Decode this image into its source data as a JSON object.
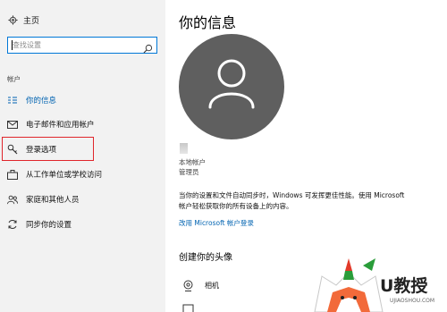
{
  "sidebar": {
    "home_label": "主页",
    "search_placeholder": "查找设置",
    "section_label": "帐户",
    "items": [
      {
        "label": "你的信息",
        "icon": "person-card-icon",
        "active": true
      },
      {
        "label": "电子邮件和应用帐户",
        "icon": "mail-icon"
      },
      {
        "label": "登录选项",
        "icon": "key-icon"
      },
      {
        "label": "从工作单位或学校访问",
        "icon": "briefcase-icon"
      },
      {
        "label": "家庭和其他人员",
        "icon": "people-icon"
      },
      {
        "label": "同步你的设置",
        "icon": "sync-icon"
      }
    ]
  },
  "main": {
    "title": "你的信息",
    "account_type": "本地帐户",
    "role": "管理员",
    "description": "当你的设置和文件自动同步时，Windows 可发挥更佳性能。使用 Microsoft 帐户轻松获取你的所有设备上的内容。",
    "link": "改用 Microsoft 帐户登录",
    "create_avatar_heading": "创建你的头像",
    "options": [
      {
        "label": "相机",
        "icon": "camera-icon"
      },
      {
        "label": "",
        "icon": "browse-icon"
      }
    ]
  },
  "watermark": {
    "brand": "U教授",
    "site": "UJIAOSHOU.COM"
  },
  "colors": {
    "accent": "#0078d7",
    "link": "#0063b1",
    "highlight_border": "#e0252b",
    "avatar_bg": "#5f5f5f",
    "sidebar_bg": "#f2f2f2"
  }
}
